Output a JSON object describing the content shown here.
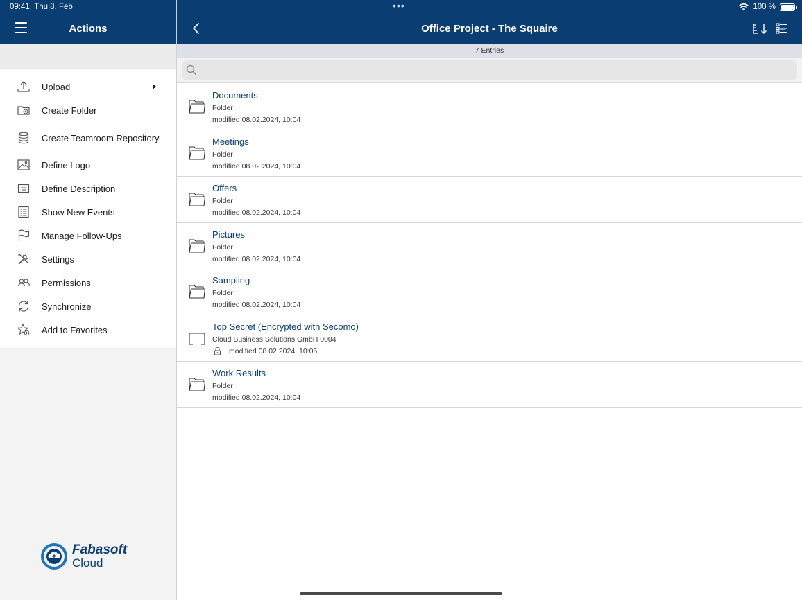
{
  "status_bar": {
    "time": "09:41",
    "date": "Thu 8. Feb",
    "multitask_dots": "•••",
    "battery_percent": "100 %",
    "battery_level": 1.0
  },
  "sidebar": {
    "title": "Actions",
    "menu_icon": "hamburger-icon",
    "items": [
      {
        "label": "Upload",
        "icon": "upload-icon",
        "has_submenu": true
      },
      {
        "label": "Create Folder",
        "icon": "create-folder-icon"
      },
      {
        "label": "Create Teamroom Repository",
        "icon": "database-icon"
      },
      {
        "label": "Define Logo",
        "icon": "image-icon"
      },
      {
        "label": "Define Description",
        "icon": "description-icon"
      },
      {
        "label": "Show New Events",
        "icon": "events-icon"
      },
      {
        "label": "Manage Follow-Ups",
        "icon": "flag-icon"
      },
      {
        "label": "Settings",
        "icon": "tools-icon"
      },
      {
        "label": "Permissions",
        "icon": "people-icon"
      },
      {
        "label": "Synchronize",
        "icon": "sync-icon"
      },
      {
        "label": "Add to Favorites",
        "icon": "star-add-icon"
      }
    ],
    "logo": {
      "line1": "Fabasoft",
      "line2": "Cloud",
      "brand_color": "#0a3d72"
    }
  },
  "main": {
    "title": "Office Project - The Squaire",
    "back_icon": "chevron-left-icon",
    "sort_icon": "sort-icon",
    "view_icon": "list-view-icon",
    "entries_label": "7 Entries",
    "search": {
      "value": "",
      "placeholder": ""
    },
    "items": [
      {
        "name": "Documents",
        "type": "Folder",
        "modified": "modified 08.02.2024, 10:04",
        "icon": "folder-icon",
        "locked": false
      },
      {
        "name": "Meetings",
        "type": "Folder",
        "modified": "modified 08.02.2024, 10:04",
        "icon": "folder-icon",
        "locked": false
      },
      {
        "name": "Offers",
        "type": "Folder",
        "modified": "modified 08.02.2024, 10:04",
        "icon": "folder-icon",
        "locked": false
      },
      {
        "name": "Pictures",
        "type": "Folder",
        "modified": "modified 08.02.2024, 10:04",
        "icon": "folder-icon",
        "locked": false
      },
      {
        "name": "Sampling",
        "type": "Folder",
        "modified": "modified 08.02.2024, 10:04",
        "icon": "folder-icon",
        "locked": false
      },
      {
        "name": "Top Secret (Encrypted with Secomo)",
        "type": "Cloud Business Solutions GmbH 0004",
        "modified": "modified 08.02.2024, 10:05",
        "icon": "encrypted-room-icon",
        "locked": true
      },
      {
        "name": "Work Results",
        "type": "Folder",
        "modified": "modified 08.02.2024, 10:04",
        "icon": "folder-icon",
        "locked": false
      }
    ]
  },
  "colors": {
    "header": "#0a3d72",
    "link_text": "#0a3d72",
    "sidebar_bg": "#f3f3f3"
  }
}
